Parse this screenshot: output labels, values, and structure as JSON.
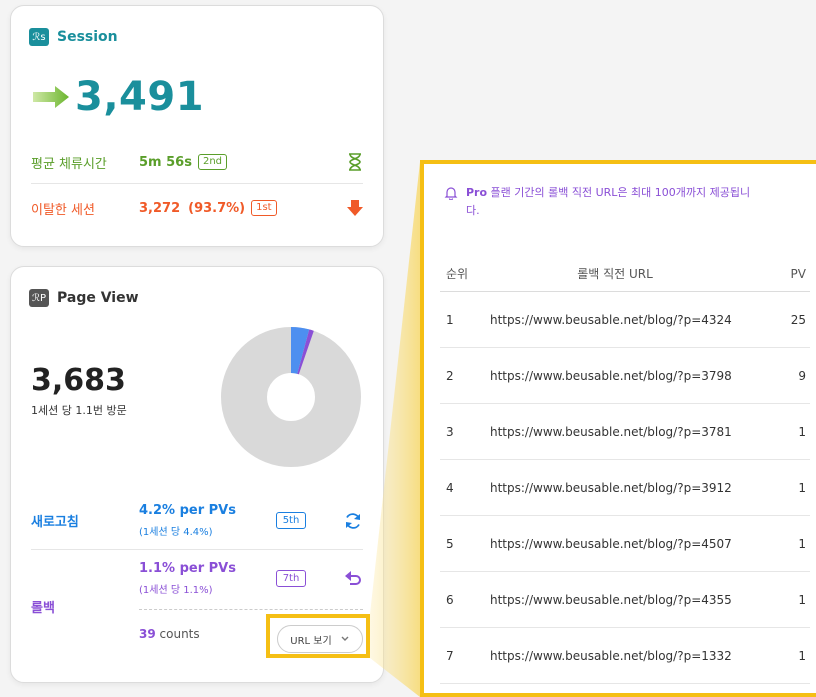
{
  "session": {
    "title": "Session",
    "icon": "session-person-icon",
    "icon_text": "ℛs",
    "total": "3,491",
    "avg_label": "평균 체류시간",
    "avg_value": "5m 56s",
    "avg_rank": "2nd",
    "exit_label": "이탈한 세션",
    "exit_value": "3,272",
    "exit_pct": "(93.7%)",
    "exit_rank": "1st",
    "colors": {
      "accent": "#1a8f9c",
      "green": "#5a9e2a",
      "red": "#f05a28"
    }
  },
  "pageview": {
    "title": "Page View",
    "icon": "pageview-person-icon",
    "icon_text": "ℛP",
    "total": "3,683",
    "sub": "1세션 당 1.1번 방문",
    "refresh_label": "새로고침",
    "refresh_main": "4.2% per PVs",
    "refresh_sub": "(1세션 당 4.4%)",
    "refresh_rank": "5th",
    "back_label": "롤백",
    "back_main": "1.1% per PVs",
    "back_sub": "(1세션 당 1.1%)",
    "back_rank": "7th",
    "counts_num": "39",
    "counts_label": "counts",
    "url_button": "URL 보기",
    "donut_blue_pct": 4.2,
    "donut_purple_pct": 1.1,
    "colors": {
      "blue": "#1a7fe0",
      "purple": "#8a4fd6",
      "gray": "#d9d9d9"
    }
  },
  "rollback_panel": {
    "notice_bold": "Pro",
    "notice_text": " 플랜 기간의 롤백 직전 URL은 최대 100개까지 제공됩니다.",
    "headers": {
      "rank": "순위",
      "url": "롤백 직전 URL",
      "pv": "PV"
    },
    "rows": [
      {
        "rank": "1",
        "url": "https://www.beusable.net/blog/?p=4324",
        "pv": "25"
      },
      {
        "rank": "2",
        "url": "https://www.beusable.net/blog/?p=3798",
        "pv": "9"
      },
      {
        "rank": "3",
        "url": "https://www.beusable.net/blog/?p=3781",
        "pv": "1"
      },
      {
        "rank": "4",
        "url": "https://www.beusable.net/blog/?p=3912",
        "pv": "1"
      },
      {
        "rank": "5",
        "url": "https://www.beusable.net/blog/?p=4507",
        "pv": "1"
      },
      {
        "rank": "6",
        "url": "https://www.beusable.net/blog/?p=4355",
        "pv": "1"
      },
      {
        "rank": "7",
        "url": "https://www.beusable.net/blog/?p=1332",
        "pv": "1"
      }
    ]
  },
  "highlight_color": "#f5bf14"
}
